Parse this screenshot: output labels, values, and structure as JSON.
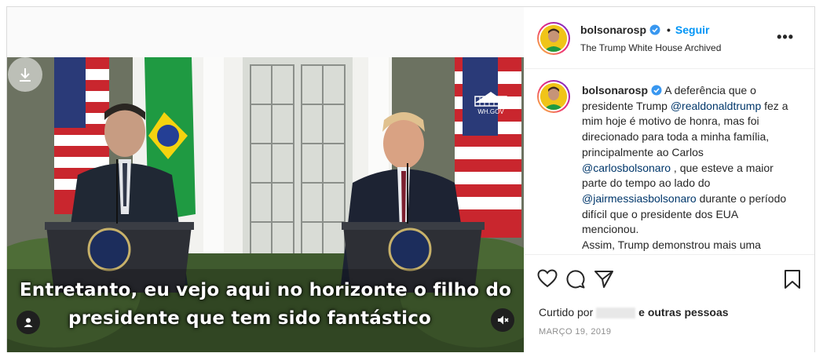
{
  "post": {
    "username": "bolsonarosp",
    "separator": "•",
    "follow_label": "Seguir",
    "location": "The Trump White House Archived",
    "more_label": "•••"
  },
  "video": {
    "caption_line1": "Entretanto, eu vejo aqui no horizonte o filho do",
    "caption_line2": "presidente que tem sido fantástico",
    "watermark": "WH.GOV"
  },
  "comment": {
    "username": "bolsonarosp",
    "t1": " A deferência que o presidente Trump ",
    "m1": "@realdonaldtrump",
    "t2": " fez a mim hoje é motivo de honra, mas foi direcionado para toda a minha família, principalmente ao Carlos ",
    "m2": "@carlosbolsonaro",
    "t3": " , que esteve a maior parte do tempo ao lado do ",
    "m3": "@jairmessiasbolsonaro",
    "t4": " durante o período difícil que o presidente dos EUA mencionou.",
    "t5": "Assim, Trump demonstrou mais uma"
  },
  "likes": {
    "prefix": "Curtido por",
    "suffix": "e outras pessoas"
  },
  "date": "MARÇO 19, 2019",
  "colors": {
    "link_blue": "#0095f6",
    "mention": "#00376b",
    "border": "#dbdbdb"
  }
}
